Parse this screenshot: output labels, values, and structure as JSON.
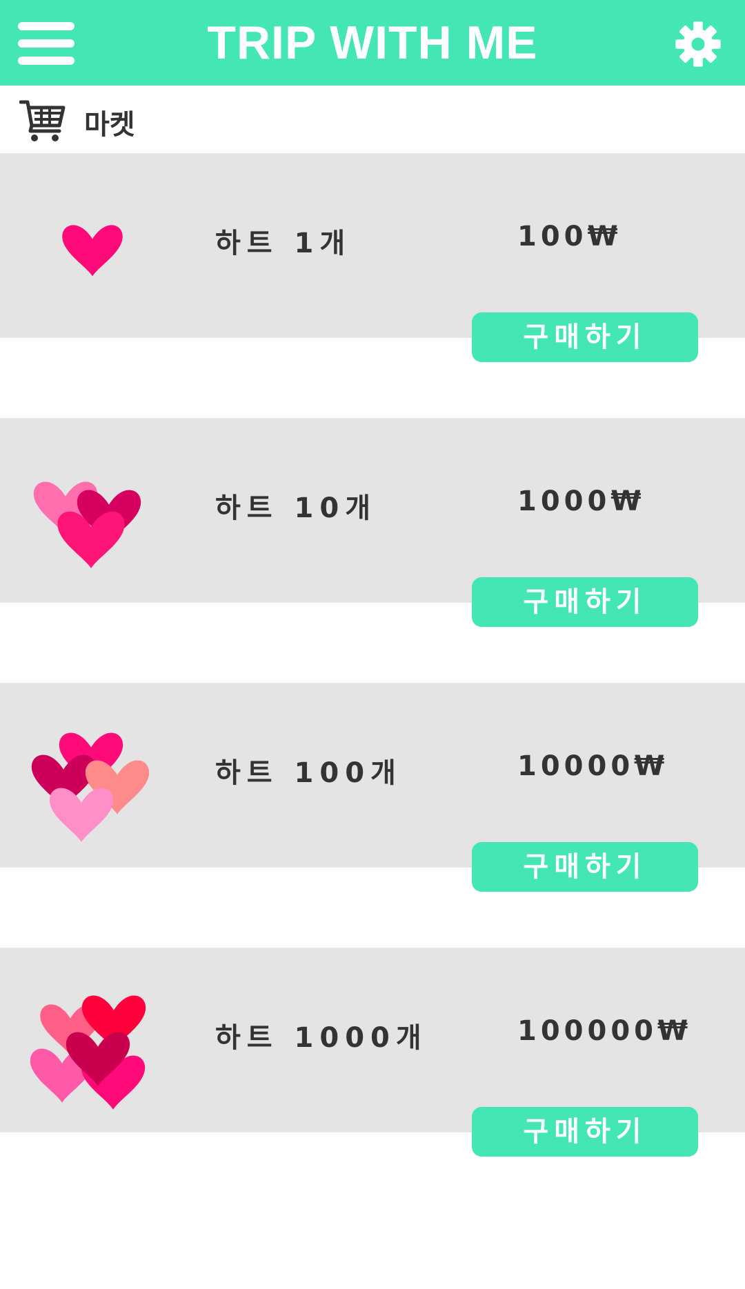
{
  "app": {
    "title": "TRIP WITH ME",
    "menu_icon": "hamburger-menu-icon",
    "settings_icon": "gear-icon",
    "brand_color": "#43e6b4"
  },
  "section": {
    "icon": "shopping-cart-icon",
    "title": "마켓"
  },
  "items": [
    {
      "name": "하트 1개",
      "price": "100₩",
      "buy_label": "구매하기",
      "icon": "single-heart-icon"
    },
    {
      "name": "하트 10개",
      "price": "1000₩",
      "buy_label": "구매하기",
      "icon": "three-hearts-icon"
    },
    {
      "name": "하트 100개",
      "price": "10000₩",
      "buy_label": "구매하기",
      "icon": "four-hearts-icon"
    },
    {
      "name": "하트 1000개",
      "price": "100000₩",
      "buy_label": "구매하기",
      "icon": "five-hearts-icon"
    }
  ]
}
